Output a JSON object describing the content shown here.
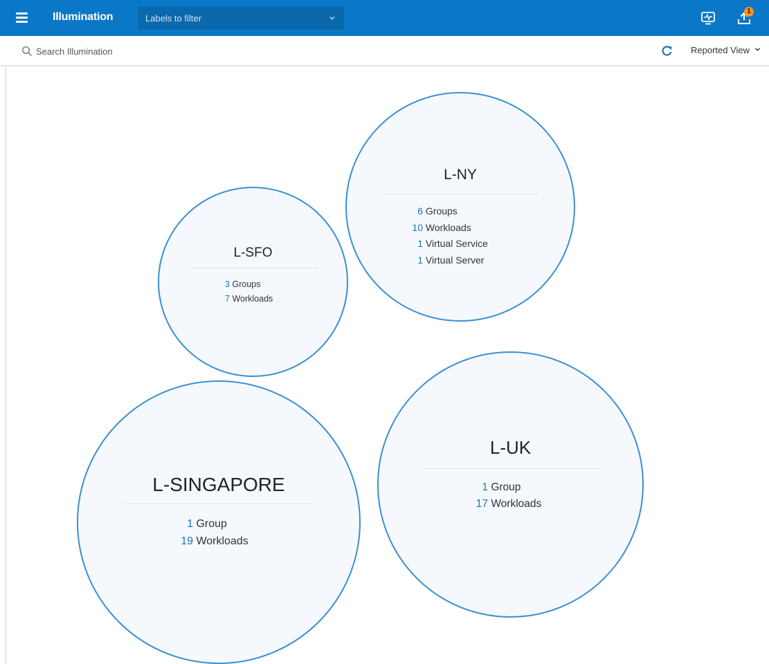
{
  "header": {
    "app_title": "Illumination",
    "label_filter_placeholder": "Labels to filter",
    "notification_count": "1"
  },
  "toolbar": {
    "search_placeholder": "Search Illumination",
    "view_mode": "Reported View"
  },
  "groups": [
    {
      "name": "L-NY",
      "stats": [
        {
          "count": "6",
          "label": "Groups"
        },
        {
          "count": "10",
          "label": "Workloads"
        },
        {
          "count": "1",
          "label": "Virtual Service"
        },
        {
          "count": "1",
          "label": "Virtual Server"
        }
      ]
    },
    {
      "name": "L-SFO",
      "stats": [
        {
          "count": "3",
          "label": "Groups"
        },
        {
          "count": "7",
          "label": "Workloads"
        }
      ]
    },
    {
      "name": "L-SINGAPORE",
      "stats": [
        {
          "count": "1",
          "label": "Group"
        },
        {
          "count": "19",
          "label": "Workloads"
        }
      ]
    },
    {
      "name": "L-UK",
      "stats": [
        {
          "count": "1",
          "label": "Group"
        },
        {
          "count": "17",
          "label": "Workloads"
        }
      ]
    }
  ],
  "colors": {
    "header_bg": "#0a78c7",
    "bubble_border": "#3a8fd2",
    "count_text": "#1f73b7",
    "badge": "#f7941d"
  }
}
